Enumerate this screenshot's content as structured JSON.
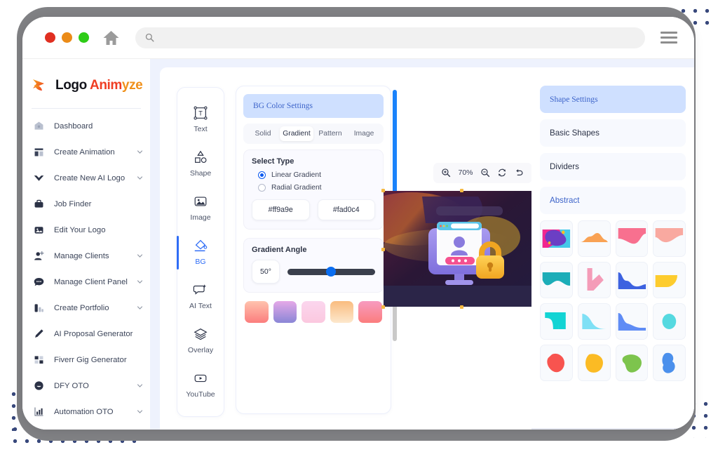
{
  "browser": {
    "traffic_lights": [
      "close",
      "minimize",
      "maximize"
    ],
    "home_icon": "home-icon",
    "search": {
      "value": "",
      "placeholder": ""
    },
    "menu_icon": "hamburger-menu-icon"
  },
  "sidebar": {
    "brand": {
      "part1": "Logo ",
      "part2": "Anim",
      "part3": "yze"
    },
    "items": [
      {
        "label": "Dashboard",
        "icon": "dashboard-icon",
        "expandable": false
      },
      {
        "label": "Create Animation",
        "icon": "animation-icon",
        "expandable": true
      },
      {
        "label": "Create New AI Logo",
        "icon": "ai-logo-icon",
        "expandable": true
      },
      {
        "label": "Job Finder",
        "icon": "briefcase-icon",
        "expandable": false
      },
      {
        "label": "Edit Your Logo",
        "icon": "image-edit-icon",
        "expandable": false
      },
      {
        "label": "Manage Clients",
        "icon": "user-add-icon",
        "expandable": true
      },
      {
        "label": "Manage Client Panel",
        "icon": "chat-icon",
        "expandable": true
      },
      {
        "label": "Create Portfolio",
        "icon": "portfolio-icon",
        "expandable": true
      },
      {
        "label": "AI Proposal Generator",
        "icon": "pencil-icon",
        "expandable": false
      },
      {
        "label": "Fiverr Gig Generator",
        "icon": "grid-icon",
        "expandable": false
      },
      {
        "label": "DFY OTO",
        "icon": "smile-icon",
        "expandable": true
      },
      {
        "label": "Automation OTO",
        "icon": "bar-chart-icon",
        "expandable": true
      }
    ]
  },
  "tool_rail": {
    "tools": [
      {
        "label": "Text",
        "icon": "text-tool-icon",
        "active": false
      },
      {
        "label": "Shape",
        "icon": "shape-tool-icon",
        "active": false
      },
      {
        "label": "Image",
        "icon": "image-tool-icon",
        "active": false
      },
      {
        "label": "BG",
        "icon": "bg-fill-tool-icon",
        "active": true
      },
      {
        "label": "AI Text",
        "icon": "ai-text-tool-icon",
        "active": false
      },
      {
        "label": "Overlay",
        "icon": "overlay-layers-icon",
        "active": false
      },
      {
        "label": "YouTube",
        "icon": "youtube-tool-icon",
        "active": false
      }
    ]
  },
  "settings_panel": {
    "title": "BG Color Settings",
    "tabs": [
      {
        "label": "Solid",
        "active": false
      },
      {
        "label": "Gradient",
        "active": true
      },
      {
        "label": "Pattern",
        "active": false
      },
      {
        "label": "Image",
        "active": false
      }
    ],
    "select_type_label": "Select Type",
    "gradient_types": [
      {
        "label": "Linear Gradient",
        "checked": true
      },
      {
        "label": "Radial Gradient",
        "checked": false
      }
    ],
    "color_fields": [
      {
        "value": "#ff9a9e"
      },
      {
        "value": "#fad0c4"
      }
    ],
    "gradient_angle_label": "Gradient Angle",
    "gradient_angle_value": "50°",
    "gradient_angle_percent": 44,
    "presets": [
      {
        "name": "peach-coral",
        "from": "#ffc3ae",
        "to": "#fb7d7d"
      },
      {
        "name": "violet-purple",
        "from": "#e5a9e8",
        "to": "#8a86d6"
      },
      {
        "name": "soft-pink",
        "from": "#fbd6ee",
        "to": "#fbc8df"
      },
      {
        "name": "orange-cream",
        "from": "#f9bc7f",
        "to": "#fde8cd"
      },
      {
        "name": "rose-pink",
        "from": "#f79bc0",
        "to": "#fb7d7d"
      }
    ],
    "scrollbar": {
      "thumb_color": "#1a82fb",
      "track_color": "#c9c9c9"
    }
  },
  "canvas": {
    "zoom_toolbar": {
      "zoom_in_icon": "zoom-in-icon",
      "zoom_level": "70%",
      "zoom_out_icon": "zoom-out-icon",
      "refresh_icon": "refresh-icon",
      "undo_icon": "undo-icon"
    },
    "artwork_name": "secure-login-illustration"
  },
  "shapes_panel": {
    "accordions": [
      {
        "label": "Shape Settings",
        "state": "active"
      },
      {
        "label": "Basic Shapes",
        "state": "normal"
      },
      {
        "label": "Dividers",
        "state": "normal"
      },
      {
        "label": "Abstract",
        "state": "link"
      }
    ],
    "shapes": [
      {
        "name": "abstract-blob-multicolor",
        "color": "#6b3fc4"
      },
      {
        "name": "wave-hill-orange",
        "color": "#f9a254"
      },
      {
        "name": "wave-drop-pink",
        "color": "#f8708f"
      },
      {
        "name": "wave-partial-peach",
        "color": "#f9a9a0"
      },
      {
        "name": "wave-curve-teal",
        "color": "#1cadb8"
      },
      {
        "name": "corner-arrow-pink",
        "color": "#f49cb8"
      },
      {
        "name": "wave-step-blue",
        "color": "#3d62e0"
      },
      {
        "name": "quarter-circle-yellow",
        "color": "#fdcc2e"
      },
      {
        "name": "corner-notch-cyan",
        "color": "#13d4d4"
      },
      {
        "name": "slope-curve-skyblue",
        "color": "#7fe0f5"
      },
      {
        "name": "wave-slope-royalblue",
        "color": "#5f8cf5"
      },
      {
        "name": "circle-blob-aqua",
        "color": "#55d9e0"
      },
      {
        "name": "blob-red",
        "color": "#f8544f"
      },
      {
        "name": "blob-yellow",
        "color": "#fbbb24"
      },
      {
        "name": "blob-green",
        "color": "#7dc44d"
      },
      {
        "name": "blob-blue",
        "color": "#4b90ec"
      }
    ]
  },
  "decor": {
    "dot_color": "#3a4a7d",
    "frame_color": "#808184"
  }
}
